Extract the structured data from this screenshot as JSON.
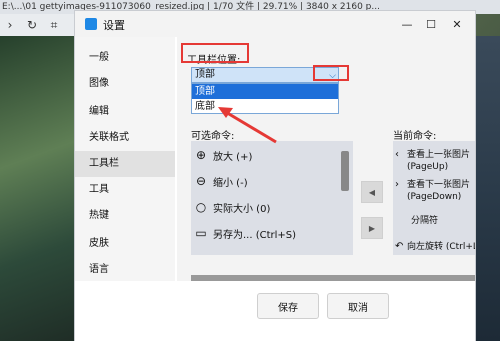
{
  "app": {
    "title": "E:\\...\\01 gettyimages-911073060_resized.jpg  |  1/70 文件  |  29.71%  |  3840 x 2160 p...",
    "toolbar_icons": [
      "forward-icon",
      "rotate-icon",
      "crop-icon"
    ]
  },
  "dialog": {
    "title": "设置",
    "icons": {
      "logo": "settings-logo-icon",
      "minimize": "minimize-icon",
      "maximize": "maximize-icon",
      "close": "close-icon"
    },
    "minimize_glyph": "—",
    "maximize_glyph": "☐",
    "close_glyph": "✕"
  },
  "sidebar": {
    "items": [
      {
        "label": "一般"
      },
      {
        "label": "图像"
      },
      {
        "label": "编辑"
      },
      {
        "label": "关联格式"
      },
      {
        "label": "工具栏",
        "active": true
      },
      {
        "label": "工具"
      },
      {
        "label": "热键"
      },
      {
        "label": "皮肤"
      },
      {
        "label": "语言"
      }
    ]
  },
  "toolbar_settings": {
    "position_label": "工具栏位置:",
    "position_value": "顶部",
    "dropdown_arrow": "⌵",
    "options": [
      "顶部",
      "底部"
    ],
    "highlighted_option": "顶部",
    "available_label": "可选命令:",
    "current_label": "当前命令:",
    "available_commands": [
      {
        "icon": "zoom-in-icon",
        "glyph": "⊕",
        "label": "放大 (+)"
      },
      {
        "icon": "zoom-out-icon",
        "glyph": "⊖",
        "label": "缩小 (-)"
      },
      {
        "icon": "actual-size-icon",
        "glyph": "○",
        "label": "实际大小 (0)"
      },
      {
        "icon": "save-as-icon",
        "glyph": "▭",
        "label": "另存为... (Ctrl+S)"
      }
    ],
    "current_commands": [
      {
        "icon": "prev-image-icon",
        "glyph": "‹",
        "label": "查看上一张图片 (PageUp)"
      },
      {
        "icon": "next-image-icon",
        "glyph": "›",
        "label": "查看下一张图片 (PageDown)"
      },
      {
        "icon": "separator-icon",
        "glyph": "",
        "label": "分隔符"
      },
      {
        "icon": "rotate-left-icon",
        "glyph": "↶",
        "label": "向左旋转 (Ctrl+L)"
      }
    ],
    "move_left_glyph": "◀",
    "move_right_glyph": "▶"
  },
  "footer": {
    "save_label": "保存",
    "cancel_label": "取消"
  },
  "colors": {
    "highlight_red": "#e53935",
    "selection_blue": "#1e6fd9",
    "select_bg": "#cfe3f8"
  }
}
